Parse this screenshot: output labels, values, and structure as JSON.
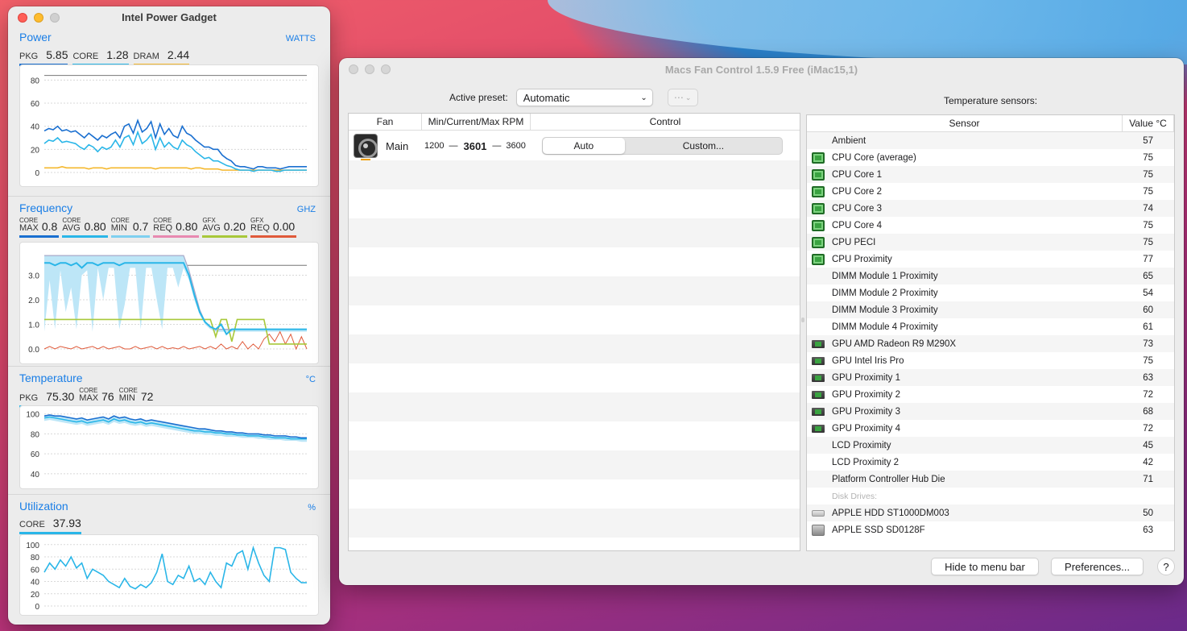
{
  "wallpaper": {
    "colors": [
      "#f2616a",
      "#b8327a",
      "#2a7fc8"
    ]
  },
  "ipg": {
    "title": "Intel Power Gadget",
    "power": {
      "title": "Power",
      "unit": "WATTS",
      "metrics": [
        {
          "label": "PKG",
          "value": "5.85",
          "color": "#1a6fd0"
        },
        {
          "label": "CORE",
          "value": "1.28",
          "color": "#2ab6e8"
        },
        {
          "label": "DRAM",
          "value": "2.44",
          "color": "#f5b82e"
        }
      ],
      "ticks": [
        "80",
        "60",
        "40",
        "20",
        "0"
      ],
      "series": {
        "pkg": [
          36,
          38,
          37,
          40,
          36,
          37,
          35,
          36,
          33,
          30,
          34,
          31,
          28,
          32,
          30,
          33,
          35,
          30,
          40,
          42,
          34,
          45,
          35,
          38,
          44,
          30,
          42,
          33,
          38,
          32,
          30,
          40,
          34,
          32,
          28,
          25,
          22,
          22,
          20,
          20,
          15,
          12,
          10,
          6,
          5,
          5,
          4,
          3,
          5,
          5,
          4,
          4,
          4,
          3,
          4,
          5,
          5,
          5,
          5,
          5
        ],
        "core": [
          25,
          28,
          27,
          30,
          26,
          27,
          26,
          25,
          22,
          20,
          24,
          22,
          18,
          22,
          20,
          22,
          28,
          22,
          30,
          32,
          24,
          35,
          25,
          28,
          33,
          20,
          30,
          22,
          26,
          22,
          20,
          28,
          24,
          22,
          18,
          15,
          12,
          13,
          10,
          10,
          8,
          6,
          5,
          3,
          2,
          2,
          2,
          1,
          2,
          2,
          2,
          2,
          1,
          1,
          2,
          2,
          2,
          2,
          2,
          2
        ],
        "dram": [
          4,
          4,
          4,
          4,
          5,
          4,
          4,
          4,
          4,
          4,
          3,
          4,
          4,
          4,
          3,
          4,
          4,
          4,
          4,
          4,
          4,
          4,
          4,
          4,
          4,
          3,
          4,
          4,
          4,
          4,
          4,
          4,
          4,
          3,
          4,
          4,
          3,
          3,
          3,
          3,
          2,
          2,
          2,
          2,
          2,
          2,
          2,
          2,
          2,
          2,
          2,
          2,
          2,
          2,
          2,
          2,
          2,
          2,
          2,
          2
        ]
      }
    },
    "frequency": {
      "title": "Frequency",
      "unit": "GHZ",
      "metrics": [
        {
          "top": "CORE",
          "label": "MAX",
          "value": "0.8",
          "color": "#1a6fd0"
        },
        {
          "top": "CORE",
          "label": "AVG",
          "value": "0.80",
          "color": "#2ab6e8"
        },
        {
          "top": "CORE",
          "label": "MIN",
          "value": "0.7",
          "color": "#7fd0f0"
        },
        {
          "top": "CORE",
          "label": "REQ",
          "value": "0.80",
          "color": "#e889b0"
        },
        {
          "top": "GFX",
          "label": "AVG",
          "value": "0.20",
          "color": "#a8c83a"
        },
        {
          "top": "GFX",
          "label": "REQ",
          "value": "0.00",
          "color": "#e05a3a"
        }
      ],
      "ticks": [
        "3.0",
        "2.0",
        "1.0",
        "0.0"
      ],
      "series": {
        "max": [
          3.8,
          3.8,
          3.8,
          3.8,
          3.8,
          3.8,
          3.8,
          3.8,
          3.8,
          3.8,
          3.8,
          3.8,
          3.8,
          3.8,
          3.8,
          3.8,
          3.8,
          3.8,
          3.8,
          3.8,
          3.8,
          3.8,
          3.8,
          3.8,
          3.8,
          3.8,
          3.8,
          3.2,
          2.4,
          1.6,
          1.1,
          0.9,
          0.8,
          0.8,
          0.8,
          0.8,
          0.8,
          0.8,
          0.8,
          0.8,
          0.8,
          0.8,
          0.8,
          0.8,
          0.8,
          0.8,
          0.8,
          0.8,
          0.8,
          0.8
        ],
        "avg": [
          3.5,
          3.5,
          3.4,
          3.5,
          3.5,
          3.4,
          3.5,
          3.3,
          3.5,
          3.5,
          3.4,
          3.5,
          3.5,
          3.5,
          3.4,
          3.5,
          3.5,
          3.5,
          3.5,
          3.5,
          3.5,
          3.5,
          3.5,
          3.5,
          3.5,
          3.5,
          3.5,
          3.0,
          2.2,
          1.5,
          1.1,
          0.9,
          0.8,
          1.0,
          0.6,
          0.8,
          0.8,
          0.8,
          0.8,
          0.8,
          0.8,
          0.8,
          0.8,
          0.8,
          0.8,
          0.8,
          0.8,
          0.8,
          0.8,
          0.8
        ],
        "min": [
          0.7,
          2.8,
          0.8,
          3.2,
          1.5,
          2.5,
          0.8,
          3.0,
          3.2,
          0.7,
          3.3,
          2.0,
          3.3,
          3.3,
          0.8,
          1.8,
          3.3,
          3.3,
          0.8,
          3.3,
          3.3,
          2.0,
          0.8,
          3.3,
          3.3,
          2.5,
          3.3,
          2.8,
          2.0,
          1.4,
          1.0,
          0.8,
          0.7,
          0.7,
          0.7,
          0.7,
          0.7,
          0.7,
          0.7,
          0.7,
          0.7,
          0.7,
          0.7,
          0.7,
          0.7,
          0.7,
          0.7,
          0.7,
          0.7,
          0.7
        ],
        "gfx_avg": [
          1.2,
          1.2,
          1.2,
          1.2,
          1.2,
          1.2,
          1.2,
          1.2,
          1.2,
          1.2,
          1.2,
          1.2,
          1.2,
          1.2,
          1.2,
          1.2,
          1.2,
          1.2,
          1.2,
          1.2,
          1.2,
          1.2,
          1.2,
          1.2,
          1.2,
          1.2,
          1.2,
          1.2,
          1.2,
          1.2,
          1.2,
          1.2,
          0.5,
          1.2,
          1.2,
          0.3,
          1.2,
          1.2,
          1.2,
          1.2,
          1.2,
          1.2,
          0.2,
          0.2,
          0.2,
          0.2,
          0.2,
          0.2,
          0.2,
          0.2
        ],
        "gfx_req": [
          0,
          0.1,
          0,
          0.1,
          0.05,
          0,
          0.1,
          0,
          0.05,
          0.1,
          0,
          0.1,
          0,
          0.05,
          0.1,
          0,
          0,
          0.1,
          0,
          0.05,
          0.1,
          0,
          0.1,
          0,
          0.05,
          0,
          0.1,
          0,
          0.05,
          0.1,
          0,
          0.1,
          0,
          0.2,
          0,
          0.1,
          0,
          0.3,
          0,
          0.2,
          0,
          0.4,
          0.6,
          0.3,
          0.7,
          0.2,
          0.6,
          0,
          0.5,
          0
        ]
      }
    },
    "temperature": {
      "title": "Temperature",
      "unit": "°C",
      "metrics": [
        {
          "label": "PKG",
          "value": "75.30",
          "color": "#2ab6e8"
        },
        {
          "top": "CORE",
          "label": "MAX",
          "value": "76",
          "color": "#1a6fd0"
        },
        {
          "top": "CORE",
          "label": "MIN",
          "value": "72",
          "color": "#ececec"
        }
      ],
      "ticks": [
        "100",
        "80",
        "60",
        "40"
      ],
      "series": {
        "max": [
          98,
          99,
          98,
          98,
          97,
          96,
          95,
          96,
          94,
          95,
          96,
          97,
          95,
          98,
          96,
          97,
          95,
          94,
          95,
          93,
          94,
          93,
          92,
          91,
          90,
          89,
          88,
          87,
          86,
          85,
          85,
          84,
          83,
          83,
          82,
          82,
          81,
          81,
          80,
          80,
          80,
          79,
          79,
          78,
          78,
          78,
          77,
          77,
          76,
          76
        ],
        "pkg": [
          96,
          97,
          96,
          95,
          94,
          93,
          92,
          93,
          91,
          92,
          93,
          94,
          92,
          95,
          93,
          94,
          92,
          91,
          92,
          90,
          91,
          90,
          89,
          88,
          87,
          86,
          85,
          84,
          83,
          83,
          82,
          82,
          81,
          81,
          80,
          80,
          79,
          79,
          78,
          78,
          78,
          77,
          77,
          76,
          76,
          76,
          75,
          75,
          75,
          75
        ],
        "min": [
          93,
          94,
          93,
          92,
          91,
          90,
          89,
          90,
          88,
          89,
          90,
          91,
          89,
          92,
          90,
          91,
          89,
          88,
          89,
          87,
          88,
          87,
          86,
          85,
          84,
          83,
          82,
          81,
          80,
          80,
          79,
          79,
          78,
          78,
          77,
          77,
          77,
          76,
          76,
          76,
          75,
          75,
          74,
          74,
          74,
          73,
          73,
          73,
          72,
          72
        ]
      }
    },
    "utilization": {
      "title": "Utilization",
      "unit": "%",
      "metrics": [
        {
          "label": "CORE",
          "value": "37.93",
          "color": "#2ab6e8"
        }
      ],
      "ticks": [
        "100",
        "80",
        "60",
        "40",
        "20",
        "0"
      ],
      "series": {
        "core": [
          55,
          70,
          60,
          75,
          65,
          80,
          62,
          70,
          45,
          60,
          55,
          50,
          40,
          35,
          30,
          45,
          32,
          28,
          35,
          30,
          38,
          55,
          85,
          40,
          35,
          50,
          45,
          65,
          40,
          45,
          35,
          55,
          40,
          30,
          70,
          65,
          85,
          90,
          60,
          95,
          70,
          50,
          40,
          95,
          95,
          92,
          55,
          45,
          38,
          38
        ]
      }
    }
  },
  "mfc": {
    "title": "Macs Fan Control 1.5.9 Free (iMac15,1)",
    "preset_label": "Active preset:",
    "preset_value": "Automatic",
    "more_glyph": "⋯",
    "temp_title": "Temperature sensors:",
    "fan_headers": [
      "Fan",
      "Min/Current/Max RPM",
      "Control"
    ],
    "fan": {
      "name": "Main",
      "min": "1200",
      "current": "3601",
      "max": "3600",
      "auto": "Auto",
      "custom": "Custom..."
    },
    "sensor_headers": [
      "Sensor",
      "Value °C"
    ],
    "sensors": [
      {
        "icon": "none",
        "name": "Ambient",
        "value": "57"
      },
      {
        "icon": "cpu",
        "name": "CPU Core (average)",
        "value": "75"
      },
      {
        "icon": "cpu",
        "name": "CPU Core 1",
        "value": "75"
      },
      {
        "icon": "cpu",
        "name": "CPU Core 2",
        "value": "75"
      },
      {
        "icon": "cpu",
        "name": "CPU Core 3",
        "value": "74"
      },
      {
        "icon": "cpu",
        "name": "CPU Core 4",
        "value": "75"
      },
      {
        "icon": "cpu",
        "name": "CPU PECI",
        "value": "75"
      },
      {
        "icon": "cpu",
        "name": "CPU Proximity",
        "value": "77"
      },
      {
        "icon": "none",
        "name": "DIMM Module 1 Proximity",
        "value": "65"
      },
      {
        "icon": "none",
        "name": "DIMM Module 2 Proximity",
        "value": "54"
      },
      {
        "icon": "none",
        "name": "DIMM Module 3 Proximity",
        "value": "60"
      },
      {
        "icon": "none",
        "name": "DIMM Module 4 Proximity",
        "value": "61"
      },
      {
        "icon": "gpu",
        "name": "GPU AMD Radeon R9 M290X",
        "value": "73"
      },
      {
        "icon": "gpu",
        "name": "GPU Intel Iris Pro",
        "value": "75"
      },
      {
        "icon": "gpu",
        "name": "GPU Proximity 1",
        "value": "63"
      },
      {
        "icon": "gpu",
        "name": "GPU Proximity 2",
        "value": "72"
      },
      {
        "icon": "gpu",
        "name": "GPU Proximity 3",
        "value": "68"
      },
      {
        "icon": "gpu",
        "name": "GPU Proximity 4",
        "value": "72"
      },
      {
        "icon": "none",
        "name": "LCD Proximity",
        "value": "45"
      },
      {
        "icon": "none",
        "name": "LCD Proximity 2",
        "value": "42"
      },
      {
        "icon": "none",
        "name": "Platform Controller Hub Die",
        "value": "71"
      },
      {
        "icon": "group",
        "name": "Disk Drives:",
        "value": ""
      },
      {
        "icon": "hdd",
        "name": "APPLE HDD ST1000DM003",
        "value": "50"
      },
      {
        "icon": "ssd",
        "name": "APPLE SSD SD0128F",
        "value": "63"
      }
    ],
    "hide_button": "Hide to menu bar",
    "prefs_button": "Preferences...",
    "help_button": "?"
  }
}
